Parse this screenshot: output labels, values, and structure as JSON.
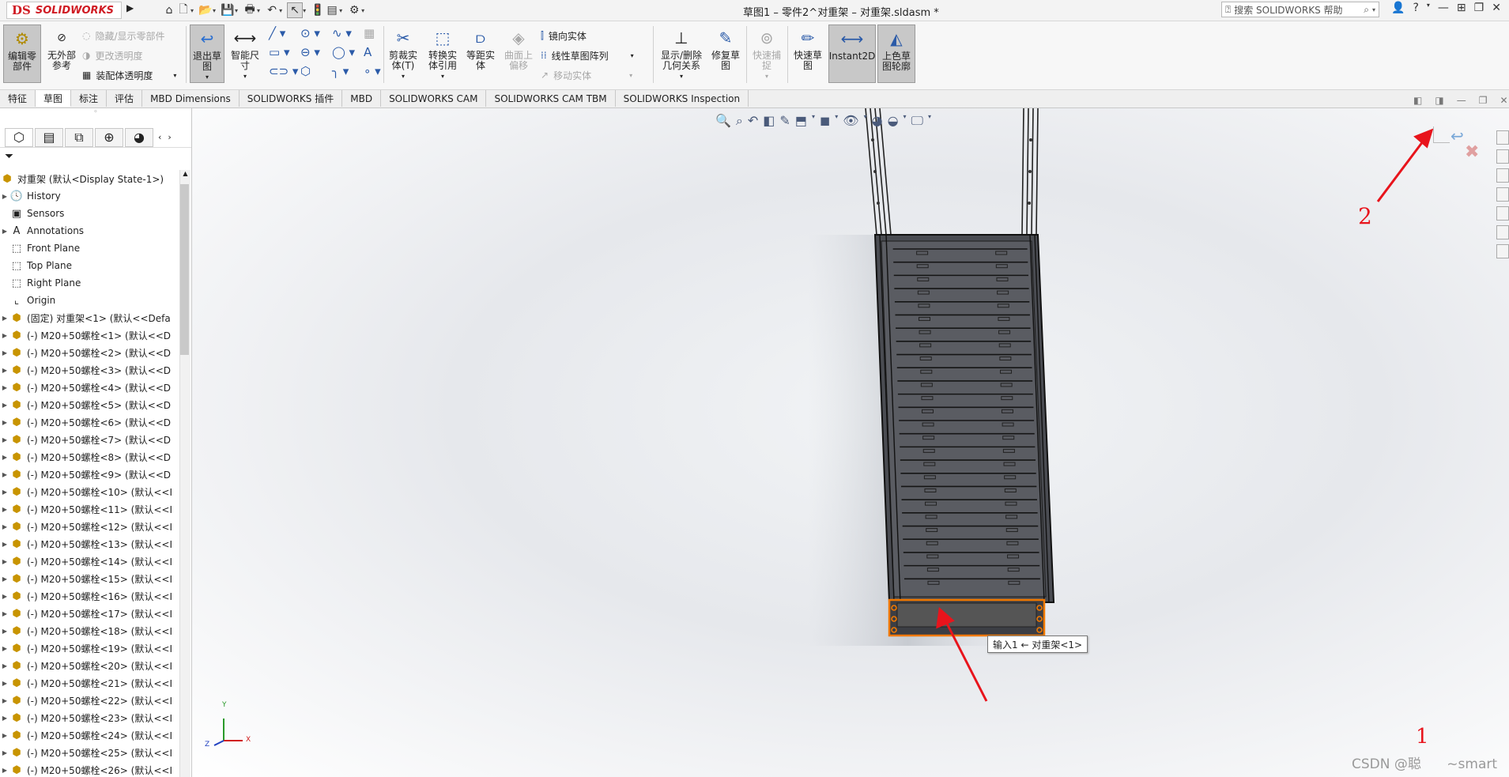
{
  "titlebar": {
    "logo_prefix": "DS",
    "logo_text": "SOLIDWORKS",
    "doc_title": "草图1 – 零件2^对重架 – 对重架.sldasm *",
    "search_placeholder": "搜索 SOLIDWORKS 帮助",
    "quick_access": [
      "home-icon",
      "new-icon",
      "open-icon",
      "save-icon",
      "print-icon",
      "undo-icon",
      "select-icon",
      "rebuild-icon",
      "file-props-icon",
      "options-icon"
    ],
    "help": "?",
    "window_controls": [
      "minimize-icon",
      "restore-icon",
      "close-icon"
    ]
  },
  "command_manager": {
    "edit_component": "编辑零\n部件",
    "no_external_ref": "无外部\n参考",
    "hide_show_comp": "隐藏/显示零部件",
    "change_transparency": "更改透明度",
    "assembly_transparency": "装配体透明度",
    "exit_sketch": "退出草\n图",
    "smart_dimension": "智能尺\n寸",
    "trim_entities": "剪裁实\n体(T)",
    "convert_entities": "转换实\n体引用",
    "offset_entities": "等距实\n体",
    "offset_on_surface": "曲面上\n偏移",
    "mirror_entities": "镜向实体",
    "linear_pattern": "线性草图阵列",
    "move_entities": "移动实体",
    "display_relations": "显示/删除\n几何关系",
    "repair_sketch": "修复草\n图",
    "quick_snaps": "快速捕\n捉",
    "rapid_sketch": "快速草\n图",
    "instant2d": "Instant2D",
    "shaded_contours": "上色草\n图轮廓"
  },
  "tabs": [
    "特征",
    "草图",
    "标注",
    "评估",
    "MBD Dimensions",
    "SOLIDWORKS 插件",
    "MBD",
    "SOLIDWORKS CAM",
    "SOLIDWORKS CAM TBM",
    "SOLIDWORKS Inspection"
  ],
  "selected_tab": "草图",
  "tree": {
    "root": "对重架  (默认<Display State-1>)",
    "history": "History",
    "sensors": "Sensors",
    "annotations": "Annotations",
    "front_plane": "Front Plane",
    "top_plane": "Top Plane",
    "right_plane": "Right Plane",
    "origin": "Origin",
    "fixed_part": "(固定) 对重架<1> (默认<<Defa",
    "bolts": [
      "(-) M20+50螺栓<1> (默认<<D",
      "(-) M20+50螺栓<2> (默认<<D",
      "(-) M20+50螺栓<3> (默认<<D",
      "(-) M20+50螺栓<4> (默认<<D",
      "(-) M20+50螺栓<5> (默认<<D",
      "(-) M20+50螺栓<6> (默认<<D",
      "(-) M20+50螺栓<7> (默认<<D",
      "(-) M20+50螺栓<8> (默认<<D",
      "(-) M20+50螺栓<9> (默认<<D",
      "(-) M20+50螺栓<10> (默认<<I",
      "(-) M20+50螺栓<11> (默认<<I",
      "(-) M20+50螺栓<12> (默认<<I",
      "(-) M20+50螺栓<13> (默认<<I",
      "(-) M20+50螺栓<14> (默认<<I",
      "(-) M20+50螺栓<15> (默认<<I",
      "(-) M20+50螺栓<16> (默认<<I",
      "(-) M20+50螺栓<17> (默认<<I",
      "(-) M20+50螺栓<18> (默认<<I",
      "(-) M20+50螺栓<19> (默认<<I",
      "(-) M20+50螺栓<20> (默认<<I",
      "(-) M20+50螺栓<21> (默认<<I",
      "(-) M20+50螺栓<22> (默认<<I",
      "(-) M20+50螺栓<23> (默认<<I",
      "(-) M20+50螺栓<24> (默认<<I",
      "(-) M20+50螺栓<25> (默认<<I",
      "(-) M20+50螺栓<26> (默认<<I"
    ]
  },
  "viewport": {
    "tooltip": "输入1 ← 对重架<1>",
    "annotation_1": "1",
    "annotation_2": "2",
    "axis_x": "X",
    "axis_y": "Y",
    "axis_z": "Z",
    "watermark": "CSDN @聪      ~smart",
    "annotation_color": "#e8141c",
    "selection_color": "#f07800"
  }
}
